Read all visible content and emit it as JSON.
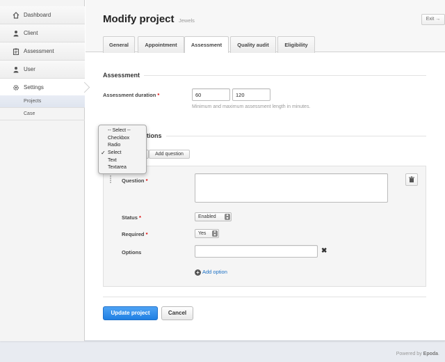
{
  "sidebar": {
    "items": [
      {
        "label": "Dashboard",
        "icon": "home-icon"
      },
      {
        "label": "Client",
        "icon": "user-icon"
      },
      {
        "label": "Assessment",
        "icon": "clipboard-icon"
      },
      {
        "label": "User",
        "icon": "user-icon"
      },
      {
        "label": "Settings",
        "icon": "gear-icon"
      }
    ],
    "subitems": [
      {
        "label": "Projects"
      },
      {
        "label": "Case"
      }
    ]
  },
  "header": {
    "title": "Modify project",
    "subtitle": "Jewels",
    "exit_label": "Exit →",
    "tabs": [
      "General",
      "Appointment",
      "Assessment",
      "Quality audit",
      "Eligibility"
    ],
    "active_tab": "Assessment"
  },
  "assessment": {
    "section_title": "Assessment",
    "duration_label": "Assessment duration",
    "duration_min": "60",
    "duration_max": "120",
    "duration_hint": "Minimum and maximum assessment length in minutes."
  },
  "questions": {
    "section_title_partial": "tions",
    "add_question_label": "Add question",
    "question_label": "Question",
    "status_label": "Status",
    "status_value": "Enabled",
    "required_label": "Required",
    "required_value": "Yes",
    "options_label": "Options",
    "add_option_label": "Add option"
  },
  "dropdown": {
    "options": [
      "-- Select --",
      "Checkbox",
      "Radio",
      "Select",
      "Text",
      "Textarea"
    ],
    "selected": "Select"
  },
  "actions": {
    "update_label": "Update project",
    "cancel_label": "Cancel"
  },
  "footer": {
    "prefix": "Powered by",
    "brand": "Epoda"
  },
  "colors": {
    "primary": "#1f7fe3",
    "link": "#1a6fc4",
    "required": "#dd0000"
  }
}
